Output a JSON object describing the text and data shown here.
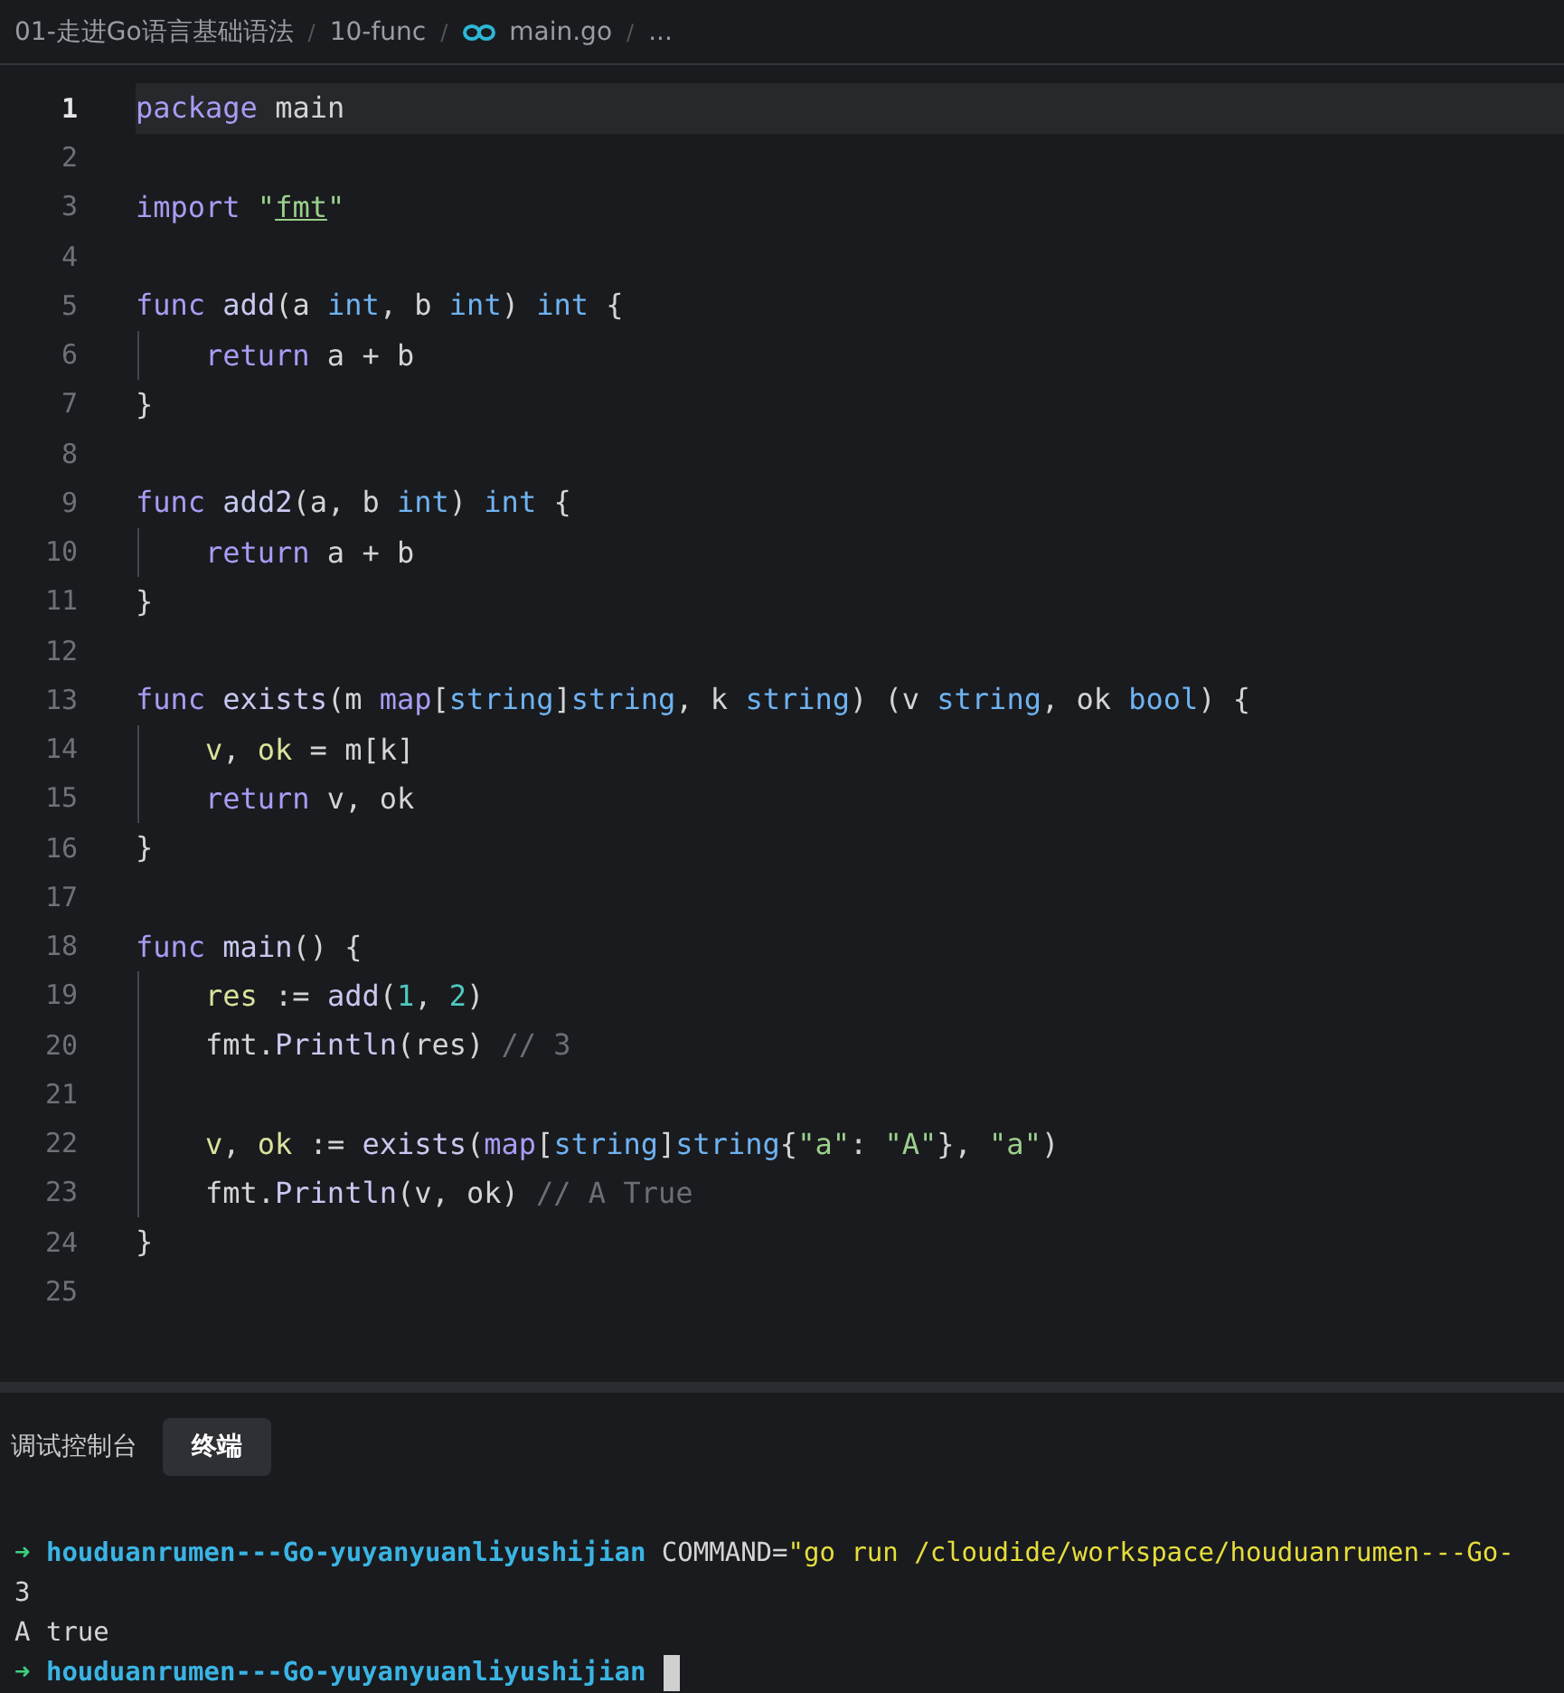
{
  "breadcrumb": [
    {
      "label": "01-走进Go语言基础语法",
      "kind": "folder",
      "separator": "/"
    },
    {
      "label": "10-func",
      "kind": "folder",
      "separator": "/"
    },
    {
      "label": "main.go",
      "kind": "gofile",
      "separator": "/"
    },
    {
      "label": "...",
      "kind": "more"
    }
  ],
  "editor": {
    "lines": [
      {
        "number": "1",
        "current": true,
        "indented": false,
        "tokens": [
          {
            "kind": "keyword",
            "text": "package"
          },
          {
            "kind": "plain",
            "text": " main"
          }
        ]
      },
      {
        "number": "2",
        "current": false,
        "indented": false
      },
      {
        "number": "3",
        "current": false,
        "indented": false,
        "tokens": [
          {
            "kind": "keyword",
            "text": "import"
          },
          {
            "kind": "string",
            "text": " \""
          },
          {
            "kind": "link",
            "text": "fmt"
          },
          {
            "kind": "string",
            "text": "\""
          }
        ]
      },
      {
        "number": "4",
        "current": false,
        "indented": false
      },
      {
        "number": "5",
        "current": false,
        "indented": false,
        "tokens": [
          {
            "kind": "keyword",
            "text": "func "
          },
          {
            "kind": "func",
            "text": "add"
          },
          {
            "kind": "plain",
            "text": "(a "
          },
          {
            "kind": "type",
            "text": "int"
          },
          {
            "kind": "plain",
            "text": ", b "
          },
          {
            "kind": "type",
            "text": "int"
          },
          {
            "kind": "plain",
            "text": ") "
          },
          {
            "kind": "type",
            "text": "int"
          },
          {
            "kind": "plain",
            "text": " {"
          }
        ]
      },
      {
        "number": "6",
        "current": false,
        "indented": true,
        "tokens": [
          {
            "kind": "keyword",
            "text": "return"
          },
          {
            "kind": "plain",
            "text": " a + b"
          }
        ]
      },
      {
        "number": "7",
        "current": false,
        "indented": false,
        "tokens": [
          {
            "kind": "plain",
            "text": "}"
          }
        ]
      },
      {
        "number": "8",
        "current": false,
        "indented": false
      },
      {
        "number": "9",
        "current": false,
        "indented": false,
        "tokens": [
          {
            "kind": "keyword",
            "text": "func "
          },
          {
            "kind": "func",
            "text": "add2"
          },
          {
            "kind": "plain",
            "text": "(a, b "
          },
          {
            "kind": "type",
            "text": "int"
          },
          {
            "kind": "plain",
            "text": ") "
          },
          {
            "kind": "type",
            "text": "int"
          },
          {
            "kind": "plain",
            "text": " {"
          }
        ]
      },
      {
        "number": "10",
        "current": false,
        "indented": true,
        "tokens": [
          {
            "kind": "keyword",
            "text": "return"
          },
          {
            "kind": "plain",
            "text": " a + b"
          }
        ]
      },
      {
        "number": "11",
        "current": false,
        "indented": false,
        "tokens": [
          {
            "kind": "plain",
            "text": "}"
          }
        ]
      },
      {
        "number": "12",
        "current": false,
        "indented": false
      },
      {
        "number": "13",
        "current": false,
        "indented": false,
        "tokens": [
          {
            "kind": "keyword",
            "text": "func "
          },
          {
            "kind": "func",
            "text": "exists"
          },
          {
            "kind": "plain",
            "text": "(m "
          },
          {
            "kind": "keyword",
            "text": "map"
          },
          {
            "kind": "plain",
            "text": "["
          },
          {
            "kind": "type",
            "text": "string"
          },
          {
            "kind": "plain",
            "text": "]"
          },
          {
            "kind": "type",
            "text": "string"
          },
          {
            "kind": "plain",
            "text": ", k "
          },
          {
            "kind": "type",
            "text": "string"
          },
          {
            "kind": "plain",
            "text": ") (v "
          },
          {
            "kind": "type",
            "text": "string"
          },
          {
            "kind": "plain",
            "text": ", ok "
          },
          {
            "kind": "type",
            "text": "bool"
          },
          {
            "kind": "plain",
            "text": ") {"
          }
        ]
      },
      {
        "number": "14",
        "current": false,
        "indented": true,
        "tokens": [
          {
            "kind": "var",
            "text": "v"
          },
          {
            "kind": "plain",
            "text": ", "
          },
          {
            "kind": "var",
            "text": "ok"
          },
          {
            "kind": "plain",
            "text": " = m[k]"
          }
        ]
      },
      {
        "number": "15",
        "current": false,
        "indented": true,
        "tokens": [
          {
            "kind": "keyword",
            "text": "return"
          },
          {
            "kind": "plain",
            "text": " v, ok"
          }
        ]
      },
      {
        "number": "16",
        "current": false,
        "indented": false,
        "tokens": [
          {
            "kind": "plain",
            "text": "}"
          }
        ]
      },
      {
        "number": "17",
        "current": false,
        "indented": false
      },
      {
        "number": "18",
        "current": false,
        "indented": false,
        "tokens": [
          {
            "kind": "keyword",
            "text": "func "
          },
          {
            "kind": "func",
            "text": "main"
          },
          {
            "kind": "plain",
            "text": "() {"
          }
        ]
      },
      {
        "number": "19",
        "current": false,
        "indented": true,
        "tokens": [
          {
            "kind": "var",
            "text": "res"
          },
          {
            "kind": "plain",
            "text": " := "
          },
          {
            "kind": "func",
            "text": "add"
          },
          {
            "kind": "plain",
            "text": "("
          },
          {
            "kind": "number",
            "text": "1"
          },
          {
            "kind": "plain",
            "text": ", "
          },
          {
            "kind": "number",
            "text": "2"
          },
          {
            "kind": "plain",
            "text": ")"
          }
        ]
      },
      {
        "number": "20",
        "current": false,
        "indented": true,
        "tokens": [
          {
            "kind": "plain",
            "text": "fmt."
          },
          {
            "kind": "func",
            "text": "Println"
          },
          {
            "kind": "plain",
            "text": "(res) "
          },
          {
            "kind": "comment",
            "text": "// 3"
          }
        ]
      },
      {
        "number": "21",
        "current": false,
        "indented": true
      },
      {
        "number": "22",
        "current": false,
        "indented": true,
        "tokens": [
          {
            "kind": "var",
            "text": "v"
          },
          {
            "kind": "plain",
            "text": ", "
          },
          {
            "kind": "var",
            "text": "ok"
          },
          {
            "kind": "plain",
            "text": " := "
          },
          {
            "kind": "func",
            "text": "exists"
          },
          {
            "kind": "plain",
            "text": "("
          },
          {
            "kind": "keyword",
            "text": "map"
          },
          {
            "kind": "plain",
            "text": "["
          },
          {
            "kind": "type",
            "text": "string"
          },
          {
            "kind": "plain",
            "text": "]"
          },
          {
            "kind": "type",
            "text": "string"
          },
          {
            "kind": "plain",
            "text": "{"
          },
          {
            "kind": "string",
            "text": "\"a\""
          },
          {
            "kind": "plain",
            "text": ": "
          },
          {
            "kind": "string",
            "text": "\"A\""
          },
          {
            "kind": "plain",
            "text": "}, "
          },
          {
            "kind": "string",
            "text": "\"a\""
          },
          {
            "kind": "plain",
            "text": ")"
          }
        ]
      },
      {
        "number": "23",
        "current": false,
        "indented": true,
        "tokens": [
          {
            "kind": "plain",
            "text": "fmt."
          },
          {
            "kind": "func",
            "text": "Println"
          },
          {
            "kind": "plain",
            "text": "(v, ok) "
          },
          {
            "kind": "comment",
            "text": "// A True"
          }
        ]
      },
      {
        "number": "24",
        "current": false,
        "indented": false,
        "tokens": [
          {
            "kind": "plain",
            "text": "}"
          }
        ]
      },
      {
        "number": "25",
        "current": false,
        "indented": false
      }
    ]
  },
  "panel_tabs": [
    {
      "label": "调试控制台",
      "selected": false
    },
    {
      "label": "终端",
      "selected": true
    }
  ],
  "terminal": [
    {
      "tokens": [
        {
          "kind": "arrow",
          "text": "➜"
        },
        {
          "kind": "dir",
          "text": " houduanrumen---Go-yuyanyuanliyushijian"
        },
        {
          "kind": "plain",
          "text": " COMMAND="
        },
        {
          "kind": "string",
          "text": "\"go run /cloudide/workspace/houduanrumen---Go-"
        }
      ]
    },
    {
      "tokens": [
        {
          "kind": "plain",
          "text": "3"
        }
      ]
    },
    {
      "tokens": [
        {
          "kind": "plain",
          "text": "A true"
        }
      ]
    },
    {
      "cursor": true,
      "tokens": [
        {
          "kind": "arrow",
          "text": "➜"
        },
        {
          "kind": "dir",
          "text": " houduanrumen---Go-yuyanyuanliyushijian"
        }
      ]
    }
  ]
}
